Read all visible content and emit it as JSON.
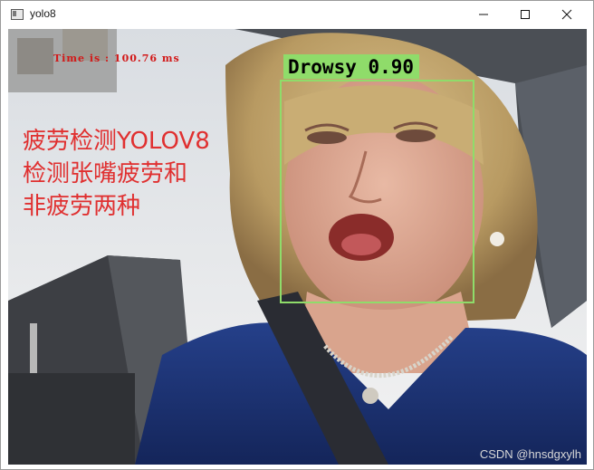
{
  "window": {
    "title": "yolo8",
    "controls": [
      "minimize-icon",
      "maximize-icon",
      "close-icon"
    ]
  },
  "frame": {
    "time_text": "Time is : 100.76 ms",
    "detection": {
      "class_name": "Drowsy",
      "confidence": "0.90",
      "label": "Drowsy 0.90",
      "box_color": "#8fdc6a"
    },
    "overlay_lines": [
      "疲劳检测YOLOV8",
      "检测张嘴疲劳和",
      "非疲劳两种"
    ],
    "overlay_color": "#e03030",
    "watermark": "CSDN @hnsdgxylh"
  }
}
